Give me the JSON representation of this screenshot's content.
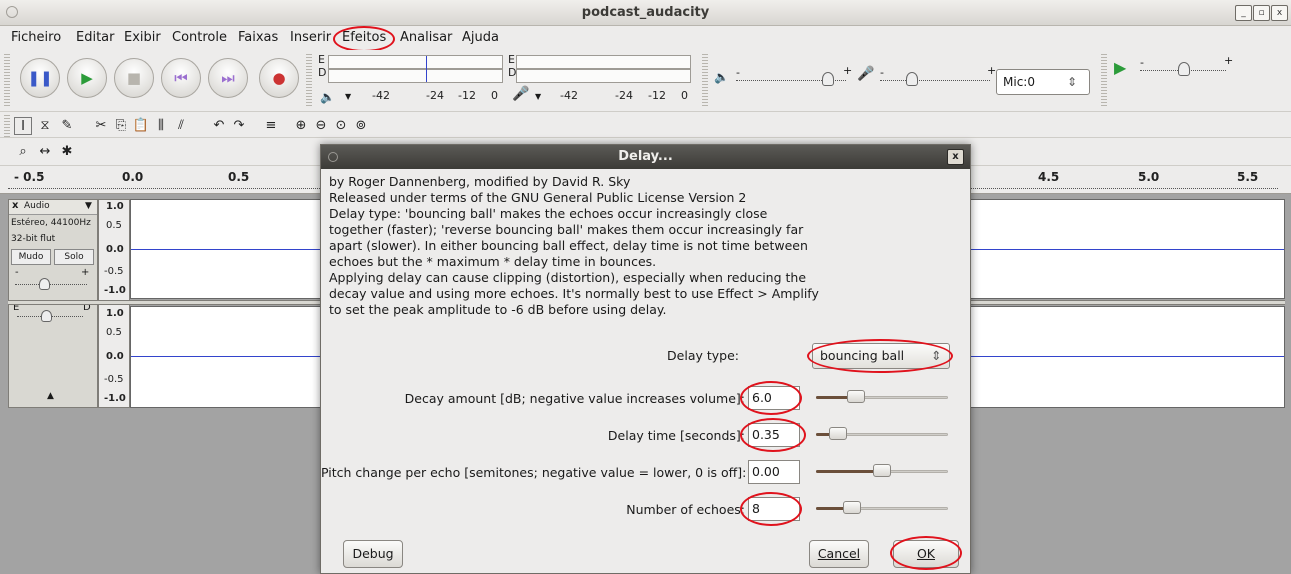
{
  "window": {
    "title": "podcast_audacity",
    "minimize": "_",
    "maximize": "▫",
    "close": "x"
  },
  "menubar": [
    {
      "label": "Ficheiro"
    },
    {
      "label": "Editar"
    },
    {
      "label": "Exibir"
    },
    {
      "label": "Controle"
    },
    {
      "label": "Faixas"
    },
    {
      "label": "Inserir"
    },
    {
      "label": "Efeitos"
    },
    {
      "label": "Analisar"
    },
    {
      "label": "Ajuda"
    }
  ],
  "transport": {
    "pause": "❚❚",
    "play": "▶",
    "stop": "■",
    "skip_start": "⏮",
    "skip_end": "⏭",
    "record": "●"
  },
  "meters": {
    "play_meter": {
      "ch1": "E",
      "ch2": "D",
      "ticks": [
        "-42",
        "-24",
        "-12",
        "0"
      ]
    },
    "rec_meter": {
      "ch1": "E",
      "ch2": "D",
      "ticks": [
        "-42",
        "-24",
        "-12",
        "0"
      ]
    }
  },
  "mixer": {
    "mic_source": "Mic:0",
    "plus": "+",
    "minus": "-"
  },
  "ruler": {
    "labels": [
      "- 0.5",
      "0.0",
      "0.5",
      "4.5",
      "5.0",
      "5.5"
    ]
  },
  "track": {
    "name": "Audio",
    "close": "x",
    "info1": "Estéreo, 44100Hz",
    "info2": "32-bit flut",
    "mute": "Mudo",
    "solo": "Solo",
    "pan_left": "E",
    "pan_right": "D",
    "gain_minus": "-",
    "gain_plus": "+",
    "collapse": "▲",
    "scale": [
      "1.0",
      "0.5",
      "0.0",
      "-0.5",
      "-1.0"
    ]
  },
  "dialog": {
    "title": "Delay...",
    "close": "x",
    "description": [
      "by Roger Dannenberg, modified by David R. Sky",
      "Released under terms of the GNU General Public License Version 2",
      "Delay type: 'bouncing ball' makes the echoes occur increasingly close",
      "together (faster); 'reverse bouncing ball' makes them occur increasingly far",
      "apart (slower). In either bouncing ball effect, delay time is not time between",
      "echoes but the * maximum * delay time in bounces.",
      "Applying delay can cause clipping (distortion), especially when reducing the",
      "decay value and using more echoes. It's normally best to use Effect > Amplify",
      "to set the peak amplitude to -6 dB before using delay."
    ],
    "delay_type_label": "Delay type:",
    "delay_type_value": "bouncing ball",
    "fields": [
      {
        "label": "Decay amount [dB; negative value increases volume]:",
        "value": "6.0",
        "level": 0.27
      },
      {
        "label": "Delay time [seconds]:",
        "value": "0.35",
        "level": 0.11
      },
      {
        "label": "Pitch change per echo [semitones; negative value = lower, 0 is off]:",
        "value": "0.00",
        "level": 0.5
      },
      {
        "label": "Number of echoes:",
        "value": "8",
        "level": 0.24
      }
    ],
    "debug_button": "Debug",
    "cancel_button": "Cancel",
    "ok_button": "OK"
  },
  "colors": {
    "annotation": "#e0121c",
    "slider_fill": "#6b4f3a",
    "waveform_line": "#3344cc",
    "titlebar_dark": "#3c3b37"
  }
}
